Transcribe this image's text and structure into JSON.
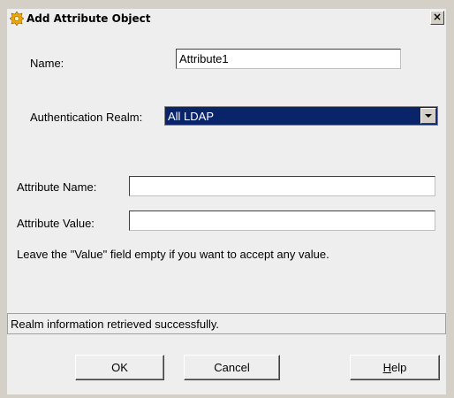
{
  "window": {
    "title": "Add Attribute Object",
    "close_glyph": "×"
  },
  "form": {
    "name_label": "Name:",
    "name_value": "Attribute1",
    "realm_label": "Authentication Realm:",
    "realm_value": "All LDAP",
    "attr_name_label": "Attribute Name:",
    "attr_name_value": "",
    "attr_value_label": "Attribute Value:",
    "attr_value_value": "",
    "hint": "Leave the \"Value\" field empty if you want to accept any value."
  },
  "status": {
    "text": "Realm information retrieved successfully."
  },
  "buttons": {
    "ok": "OK",
    "cancel": "Cancel",
    "help_mnemonic": "H",
    "help_rest": "elp"
  },
  "icons": {
    "app": "gear-star-icon",
    "close": "close-icon",
    "dropdown": "chevron-down-icon"
  },
  "colors": {
    "selection_bg": "#0a246a",
    "dialog_bg": "#eeeeee",
    "icon_fill": "#f0a800"
  }
}
